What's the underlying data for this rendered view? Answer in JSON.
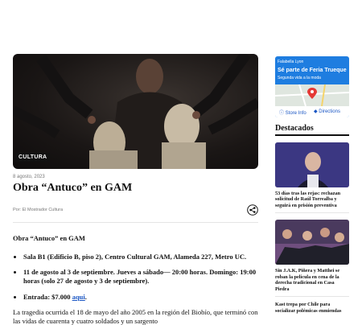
{
  "article": {
    "category": "CULTURA",
    "date": "8 agosto, 2023",
    "title": "Obra “Antuco” en GAM",
    "byline": "Por: El Mostrador Cultura",
    "lead": "Obra “Antuco” en GAM",
    "bullets": [
      "Sala B1 (Edificio B, piso 2), Centro Cultural GAM, Alameda 227, Metro UC.",
      "11 de agosto al 3 de septiembre. Jueves a sábado— 20:00 horas. Domingo: 19:00 horas (solo 27 de  agosto y 3 de septiembre)."
    ],
    "price_label": "Entrada: $7.000 ",
    "price_link": "aqui",
    "paragraph": "La tragedia ocurrida el 18 de mayo del año 2005 en la región del Biobío, que terminó con las vidas de cuarenta y cuatro soldados y un sargento"
  },
  "ad": {
    "brand": "Falabella Lyon",
    "headline": "Sé parte de Feria Trueque",
    "sub": "Segunda vida a la moda",
    "store_info": "Store Info",
    "directions": "Directions"
  },
  "destacados": {
    "title": "Destacados",
    "items": [
      {
        "text": "53 días tras las rejas: rechazan solicitud de Raúl Torrealba y seguirá en prisión preventiva"
      },
      {
        "text": "Sin J.A.K, Piñera y Matthei se roban la película en cena de la derecha tradicional en Casa Piedra"
      },
      {
        "text": "Kast trepa por Chile para socializar polémicas enmiendas"
      }
    ]
  },
  "colors": {
    "link": "#1a56c4",
    "ad_blue": "#1e7de0"
  },
  "icons": {
    "share": "share-icon",
    "pin": "location-pin-icon",
    "info": "info-icon",
    "directions": "directions-icon"
  }
}
